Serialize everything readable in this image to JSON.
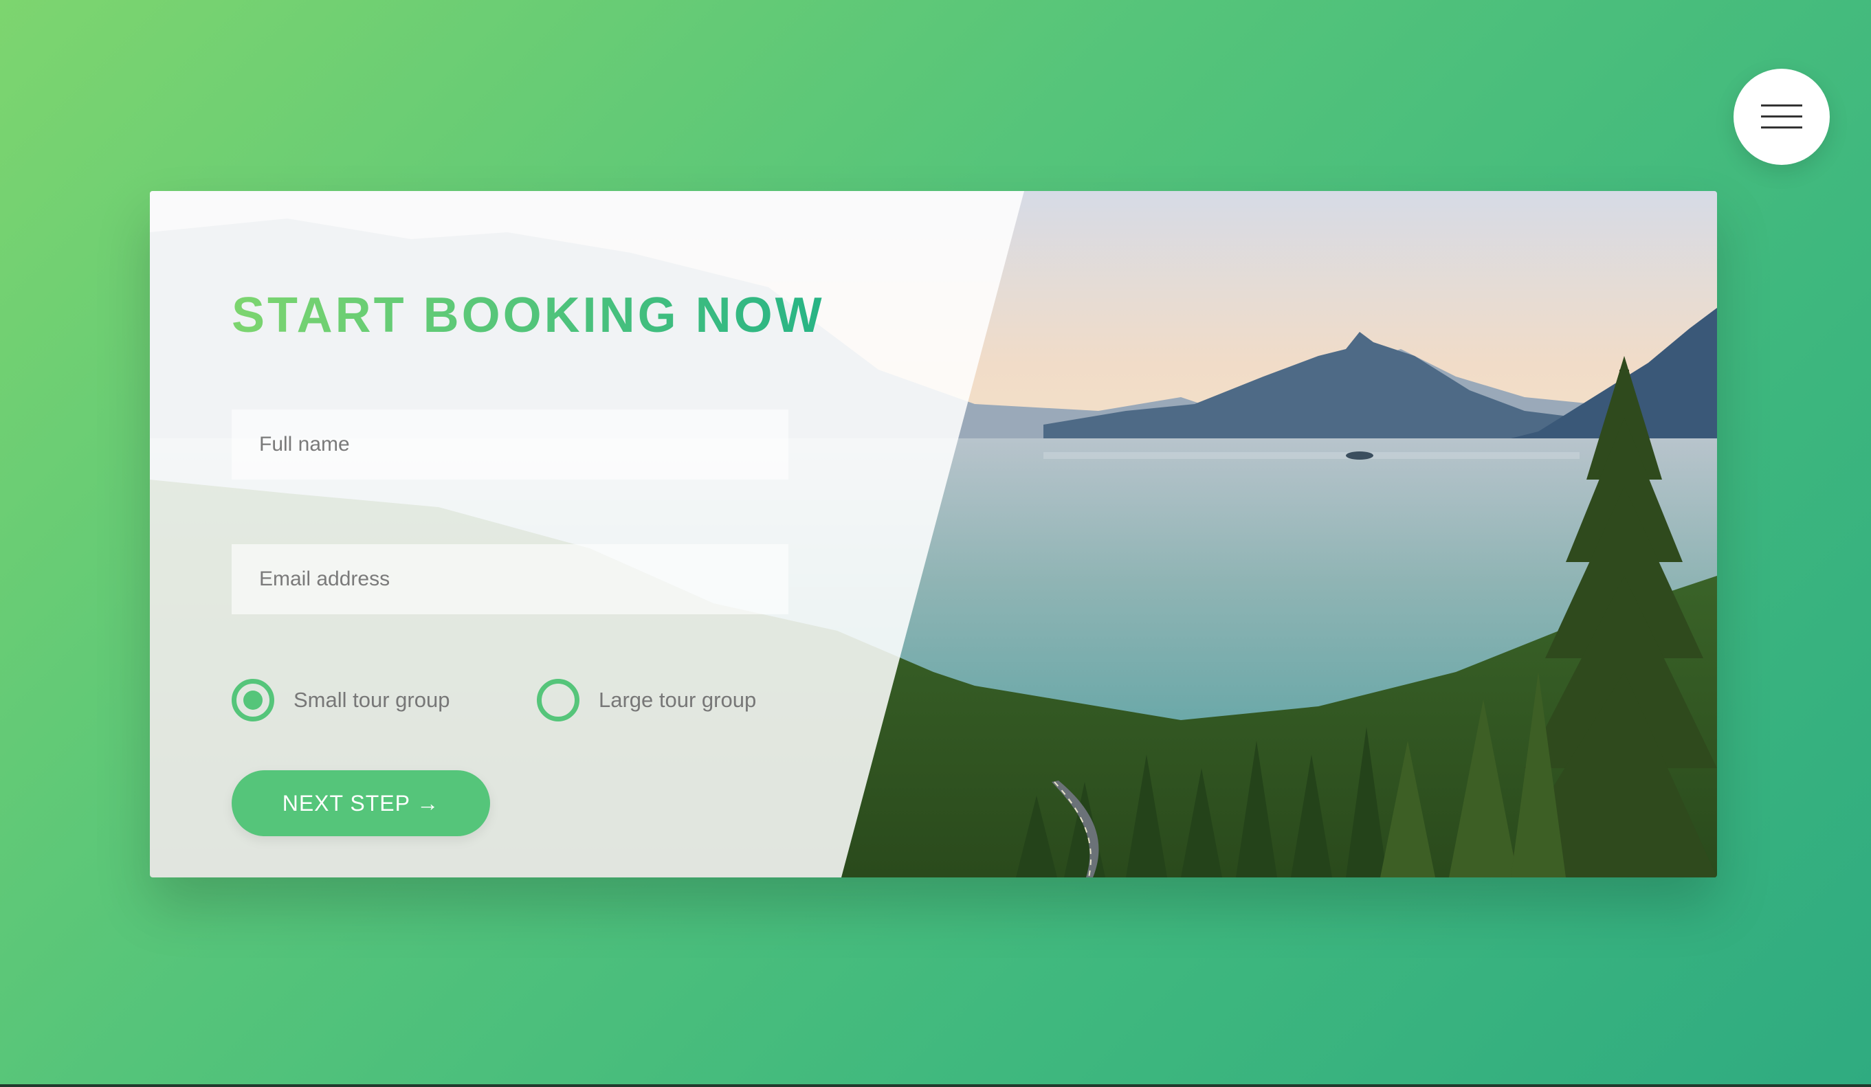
{
  "header": {
    "menu_icon": "hamburger-menu-icon"
  },
  "booking": {
    "title": "START BOOKING NOW",
    "full_name_placeholder": "Full name",
    "email_placeholder": "Email address",
    "radio_small_label": "Small tour group",
    "radio_large_label": "Large tour group",
    "radio_selected": "Small tour group",
    "next_button_label": "NEXT STEP →"
  },
  "colors": {
    "accent": "#55c57a",
    "gradient_start": "#7ed56f",
    "gradient_end": "#28b485",
    "text_gray": "#777777"
  }
}
